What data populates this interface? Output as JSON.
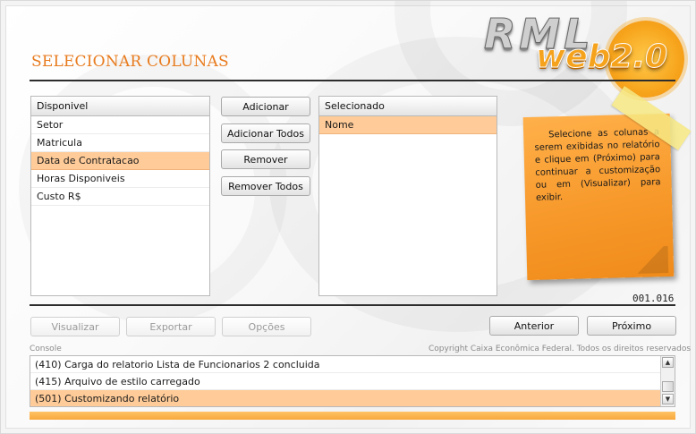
{
  "page": {
    "title": "SELECIONAR COLUNAS",
    "code": "001.016"
  },
  "logo": {
    "line1": "RML",
    "line2": "web2.0"
  },
  "available": {
    "header": "Disponivel",
    "items": [
      "Setor",
      "Matricula",
      "Data de Contratacao",
      "Horas Disponiveis",
      "Custo R$"
    ],
    "selected_index": 2
  },
  "selected": {
    "header": "Selecionado",
    "items": [
      "Nome"
    ]
  },
  "transfer_buttons": {
    "add": "Adicionar",
    "add_all": "Adicionar Todos",
    "remove": "Remover",
    "remove_all": "Remover Todos"
  },
  "note": {
    "text": "Selecione as colunas a serem exibidas no relatório e clique em (Próximo) para continuar a customização ou em (Visualizar) para exibir."
  },
  "actions": {
    "view": "Visualizar",
    "export": "Exportar",
    "options": "Opções",
    "previous": "Anterior",
    "next": "Próximo"
  },
  "console": {
    "label": "Console",
    "copyright": "Copyright Caixa Econômica Federal. Todos os direitos reservados",
    "lines": [
      "(410) Carga do relatorio Lista de Funcionarios 2 concluida",
      "(415) Arquivo de estilo carregado",
      "(501) Customizando relatório"
    ],
    "selected_index": 2
  },
  "colors": {
    "accent": "#e87b1e",
    "selection": "#ffcc99",
    "note": "#f7992b"
  }
}
